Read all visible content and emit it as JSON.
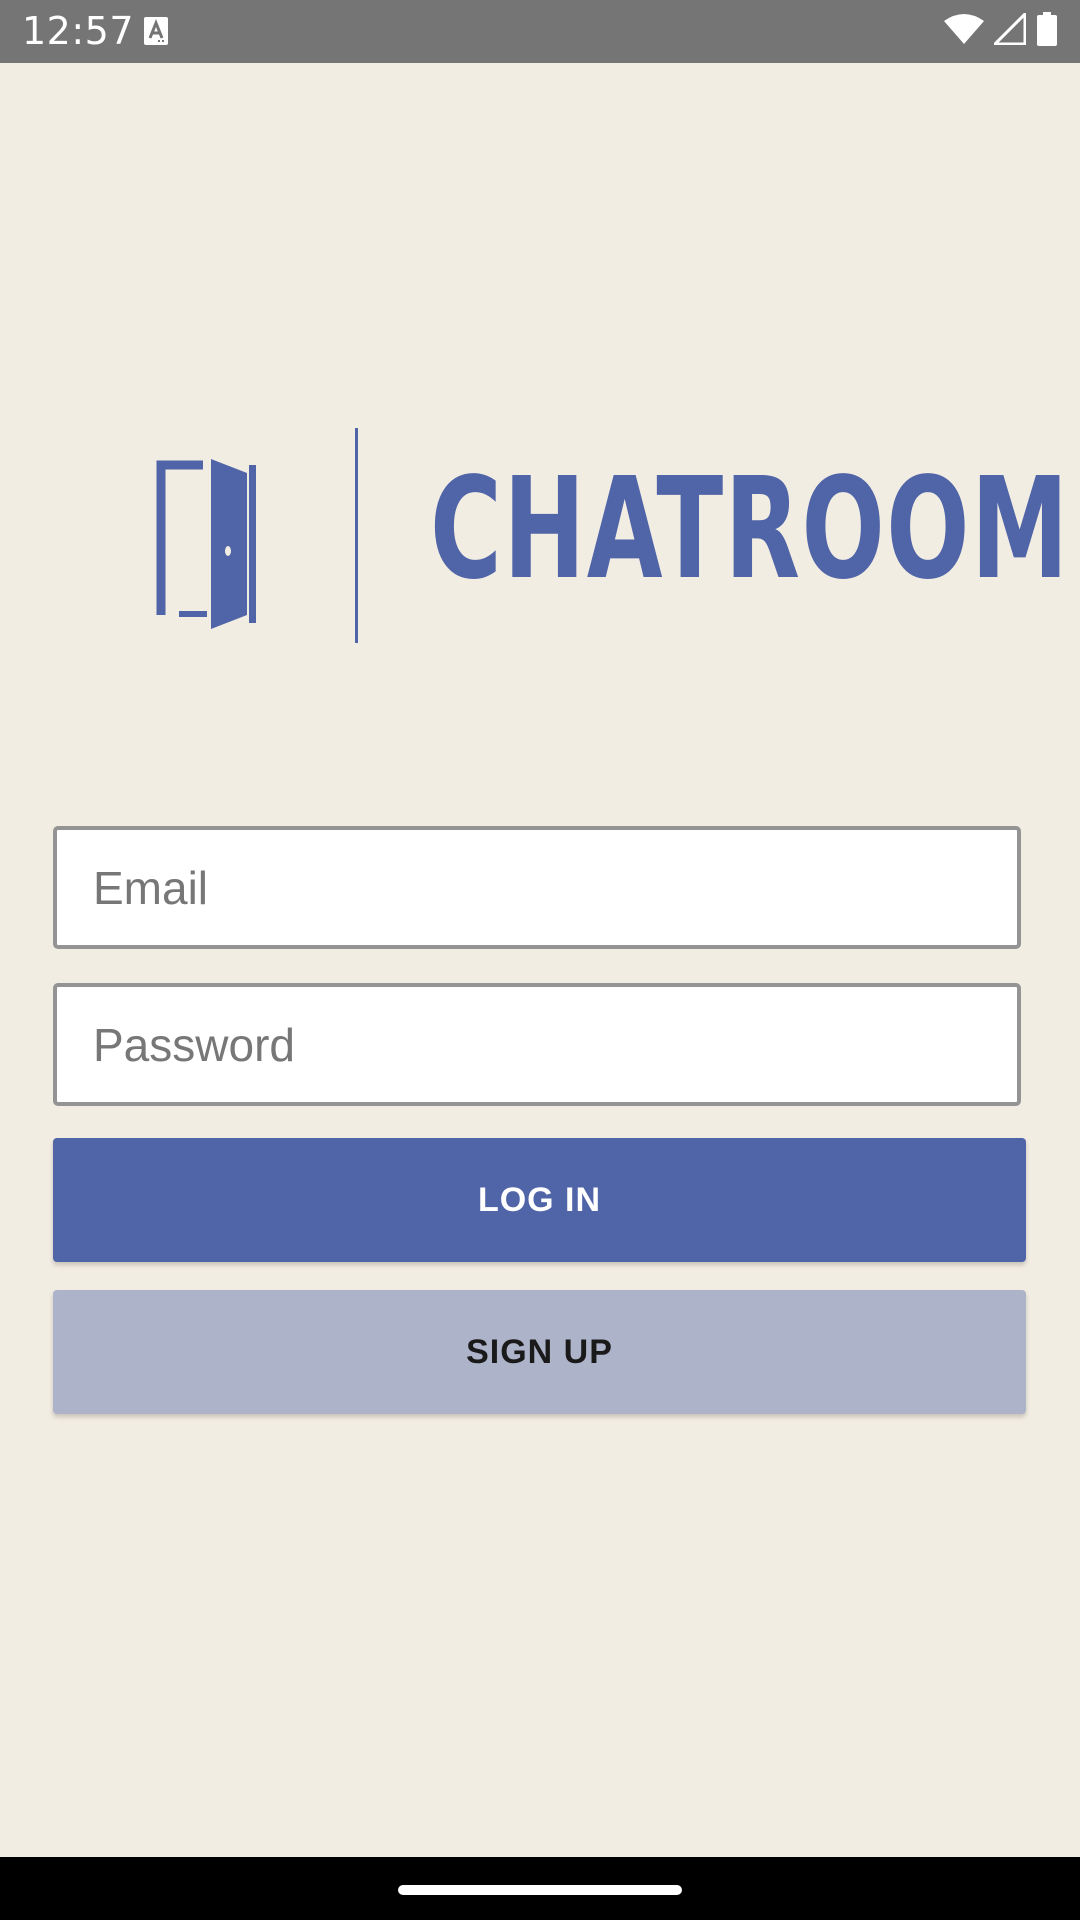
{
  "status_bar": {
    "time": "12:57",
    "icons": [
      "notification-a-icon",
      "wifi-icon",
      "signal-icon",
      "battery-icon"
    ]
  },
  "logo": {
    "icon": "open-door-icon",
    "text": "CHATROOM"
  },
  "form": {
    "email_placeholder": "Email",
    "password_placeholder": "Password",
    "login_label": "LOG IN",
    "signup_label": "SIGN UP"
  },
  "colors": {
    "background": "#f2ede3",
    "brand": "#5064a8",
    "secondary_button": "#adb3c9",
    "status_bar": "#757575"
  }
}
